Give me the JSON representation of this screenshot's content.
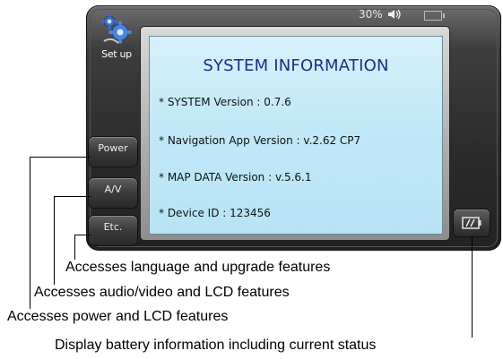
{
  "device": {
    "setup_label": "Set up",
    "battery_percent": "30%",
    "icons": [
      "setup-gear-icon",
      "speaker-icon",
      "battery-icon",
      "battery-info-icon"
    ]
  },
  "screen": {
    "title": "SYSTEM INFORMATION",
    "items": [
      "* SYSTEM Version : 0.7.6",
      "* Navigation App Version : v.2.62 CP7",
      "* MAP DATA Version : v.5.6.1",
      "* Device ID : 123456"
    ]
  },
  "side_buttons": {
    "power": "Power",
    "av": "A/V",
    "etc": "Etc."
  },
  "callouts": {
    "etc": "Accesses language and upgrade features",
    "av": "Accesses audio/video and LCD features",
    "power": "Accesses power and LCD features",
    "battery": "Display battery information including current status"
  }
}
